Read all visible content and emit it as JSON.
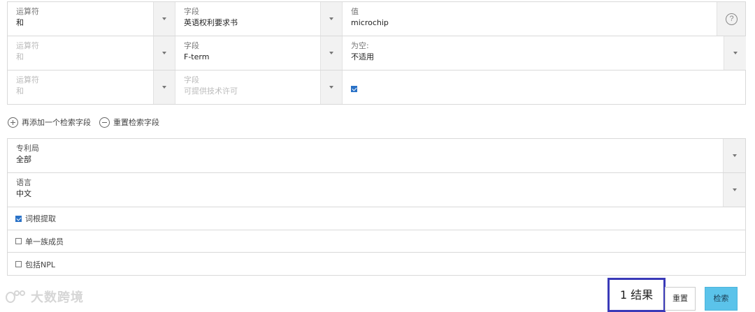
{
  "criteria_rows": [
    {
      "operator_label": "运算符",
      "operator_value": "和",
      "field_label": "字段",
      "field_value": "英语权利要求书",
      "value_label": "值",
      "value_value": "microchip"
    },
    {
      "operator_label": "运算符",
      "operator_value": "和",
      "field_label": "字段",
      "field_value": "F-term",
      "value_label": "为空:",
      "value_value": "不适用"
    },
    {
      "operator_label": "运算符",
      "operator_value": "和",
      "field_label": "字段",
      "field_value": "可提供技术许可",
      "value_checked": true
    }
  ],
  "help_icon": "?",
  "actions": {
    "add_field": "再添加一个检索字段",
    "reset_fields": "重置检索字段"
  },
  "options": {
    "office_label": "专利局",
    "office_value": "全部",
    "language_label": "语言",
    "language_value": "中文",
    "stemming": {
      "label": "词根提取",
      "checked": true
    },
    "single_family": {
      "label": "单一族成员",
      "checked": false
    },
    "include_npl": {
      "label": "包括NPL",
      "checked": false
    }
  },
  "result_count": "1 结果",
  "buttons": {
    "reset": "重置",
    "search": "检索"
  },
  "watermark": "大数跨境",
  "colors": {
    "accent": "#5bc3ea",
    "highlight_border": "#3a3ab8",
    "checkbox": "#2a72c7"
  }
}
